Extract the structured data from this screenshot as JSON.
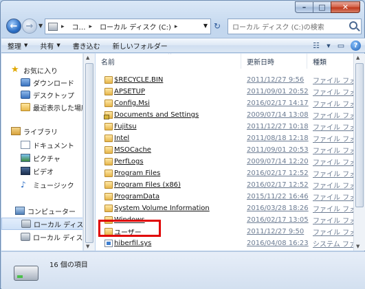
{
  "window": {
    "minimize_glyph": "–",
    "maximize_glyph": "□",
    "close_glyph": "✕"
  },
  "navigation": {
    "back_glyph": "←",
    "forward_glyph": "→",
    "dropdown_glyph": "▼",
    "address_crumbs": [
      "コ…",
      "ローカル ディスク (C:)"
    ],
    "address_sep": "▸",
    "refresh_glyph": "↻",
    "search_placeholder": "ローカル ディスク (C:)の検索"
  },
  "toolbar": {
    "organize": "整理",
    "share": "共有",
    "burn": "書き込む",
    "new_folder": "新しいフォルダー",
    "view_glyph": "☷",
    "pane_glyph": "▭",
    "help_glyph": "?"
  },
  "sidebar": {
    "items": [
      {
        "label": "お気に入り",
        "icon": "star-icon"
      },
      {
        "label": "ダウンロード",
        "icon": "download-icon"
      },
      {
        "label": "デスクトップ",
        "icon": "desktop-icon"
      },
      {
        "label": "最近表示した場所",
        "icon": "recent-places-icon"
      },
      {
        "label": "ライブラリ",
        "icon": "library-icon"
      },
      {
        "label": "ドキュメント",
        "icon": "documents-icon"
      },
      {
        "label": "ピクチャ",
        "icon": "pictures-icon"
      },
      {
        "label": "ビデオ",
        "icon": "videos-icon"
      },
      {
        "label": "ミュージック",
        "icon": "music-icon"
      },
      {
        "label": "コンピューター",
        "icon": "computer-icon"
      },
      {
        "label": "ローカル ディスク (C:)",
        "icon": "drive-icon",
        "selected": true
      },
      {
        "label": "ローカル ディスク",
        "icon": "drive-icon"
      }
    ]
  },
  "columns": {
    "name": "名前",
    "date": "更新日時",
    "type": "種類"
  },
  "files": [
    {
      "name": "$RECYCLE.BIN",
      "date": "2011/12/27 9:56",
      "type": "ファイル フォ",
      "icon": "folder"
    },
    {
      "name": "APSETUP",
      "date": "2011/09/01 20:52",
      "type": "ファイル フォ",
      "icon": "folder"
    },
    {
      "name": "Config.Msi",
      "date": "2016/02/17 14:17",
      "type": "ファイル フォ",
      "icon": "folder"
    },
    {
      "name": "Documents and Settings",
      "date": "2009/07/14 13:08",
      "type": "ファイル フォ",
      "icon": "lock"
    },
    {
      "name": "Fujitsu",
      "date": "2011/12/27 10:18",
      "type": "ファイル フォ",
      "icon": "folder"
    },
    {
      "name": "Intel",
      "date": "2011/08/18 12:18",
      "type": "ファイル フォ",
      "icon": "folder"
    },
    {
      "name": "MSOCache",
      "date": "2011/09/01 20:53",
      "type": "ファイル フォ",
      "icon": "folder"
    },
    {
      "name": "PerfLogs",
      "date": "2009/07/14 12:20",
      "type": "ファイル フォ",
      "icon": "folder"
    },
    {
      "name": "Program Files",
      "date": "2016/02/17 12:52",
      "type": "ファイル フォ",
      "icon": "folder"
    },
    {
      "name": "Program Files (x86)",
      "date": "2016/02/17 12:52",
      "type": "ファイル フォ",
      "icon": "folder"
    },
    {
      "name": "ProgramData",
      "date": "2015/11/22 16:46",
      "type": "ファイル フォ",
      "icon": "folder"
    },
    {
      "name": "System Volume Information",
      "date": "2016/03/28 18:26",
      "type": "ファイル フォ",
      "icon": "folder"
    },
    {
      "name": "Windows",
      "date": "2016/02/17 13:05",
      "type": "ファイル フォ",
      "icon": "folder"
    },
    {
      "name": "ユーザー",
      "date": "2011/12/27 9:50",
      "type": "ファイル フォ",
      "icon": "folder",
      "highlighted": true
    },
    {
      "name": "hiberfil.sys",
      "date": "2016/04/08 16:23",
      "type": "システム ファ",
      "icon": "system"
    }
  ],
  "status": {
    "item_count": "16 個の項目"
  },
  "colors": {
    "highlight": "#e00000",
    "selection": "#cfe1f7"
  }
}
